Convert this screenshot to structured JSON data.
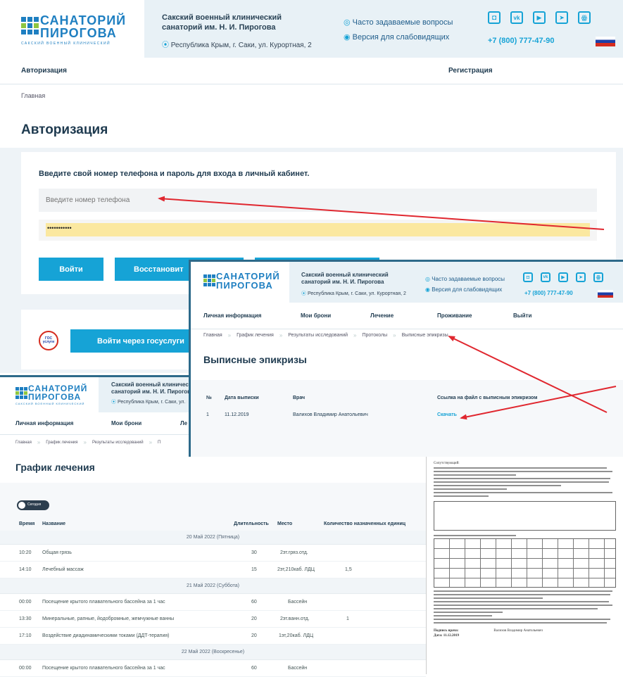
{
  "colors": {
    "accent": "#16a3d6",
    "logo": "#1e7fc1",
    "arrow": "#e0272f",
    "header_bg": "#e8f1f6"
  },
  "logo": {
    "line1": "САНАТОРИЙ",
    "line2": "ПИРОГОВА",
    "tagline": "САКСКИЙ ВОЕННЫЙ КЛИНИЧЕСКИЙ"
  },
  "header": {
    "org_line1": "Сакский военный клинический",
    "org_line2": "санаторий им. Н. И. Пирогова",
    "address": "Республика Крым, г. Саки, ул. Курортная, 2",
    "faq": "Часто задаваемые вопросы",
    "low_vision": "Версия для слабовидящих",
    "phone": "+7 (800) 777-47-90",
    "socials": [
      "ok",
      "vk",
      "youtube",
      "telegram",
      "odnoklassniki"
    ]
  },
  "login": {
    "nav_auth": "Авторизация",
    "nav_register": "Регистрация",
    "breadcrumb_home": "Главная",
    "title": "Авторизация",
    "prompt": "Введите свой номер телефона и пароль для входа в личный кабинет.",
    "phone_placeholder": "Введите номер телефона",
    "password_mask": "•••••••••••",
    "login_button": "Войти",
    "restore_button": "Восстановит",
    "gosuslugi_logo": "ГОС услуги",
    "gosuslugi_button": "Войти через госуслуги"
  },
  "cabinet_nav": [
    "Личная информация",
    "Мои брони",
    "Лечение",
    "Проживание",
    "Выйти"
  ],
  "epicrisis": {
    "breadcrumbs": [
      "Главная",
      "График лечения",
      "Результаты исследований",
      "Протоколы",
      "Выписные эпикризы"
    ],
    "title": "Выписные эпикризы",
    "columns": [
      "№",
      "Дата выписки",
      "Врач",
      "Ссылка на файл с выписным эпикризом"
    ],
    "rows": [
      {
        "n": "1",
        "date": "11.12.2019",
        "doctor": "Валихов Владимир Анатольевич",
        "link": "Скачать"
      }
    ]
  },
  "schedule": {
    "nav": [
      "Личная информация",
      "Мои брони",
      "Ле"
    ],
    "breadcrumbs": [
      "Главная",
      "График лечения",
      "Результаты исследований",
      "П"
    ],
    "title": "График лечения",
    "toggle_label": "Сегодня",
    "columns": [
      "Время",
      "Название",
      "Длительность",
      "Место",
      "Количество назначенных единиц"
    ],
    "days": [
      {
        "label": "20 Май 2022 (Пятница)",
        "rows": [
          {
            "time": "10:20",
            "name": "Общая грязь",
            "dur": "30",
            "place": "2эт.гряз.отд.",
            "qty": ""
          },
          {
            "time": "14:10",
            "name": "Лечебный массаж",
            "dur": "15",
            "place": "2эт,210каб. ЛДЦ",
            "qty": "1,5"
          }
        ]
      },
      {
        "label": "21 Май 2022 (Суббота)",
        "rows": [
          {
            "time": "00:00",
            "name": "Посещение крытого плавательного бассейна за 1 час",
            "dur": "60",
            "place": "Бассейн",
            "qty": ""
          },
          {
            "time": "13:30",
            "name": "Минеральные, рапные, йодобромные, жемчужные ванны",
            "dur": "20",
            "place": "2эт.ванн.отд.",
            "qty": "1"
          },
          {
            "time": "17:10",
            "name": "Воздействие диадинамическими токами (ДДТ-терапия)",
            "dur": "20",
            "place": "1эт,20каб. ЛДЦ",
            "qty": ""
          }
        ]
      },
      {
        "label": "22 Май 2022 (Воскресенье)",
        "rows": [
          {
            "time": "00:00",
            "name": "Посещение крытого плавательного бассейна за 1 час",
            "dur": "60",
            "place": "Бассейн",
            "qty": ""
          }
        ]
      }
    ]
  },
  "document": {
    "heading": "Сопутствующий:",
    "sign_label": "Подпись врача:",
    "sign_name": "Валихов Владимир Анатольевич",
    "date_label": "Дата: 11.12.2019"
  }
}
